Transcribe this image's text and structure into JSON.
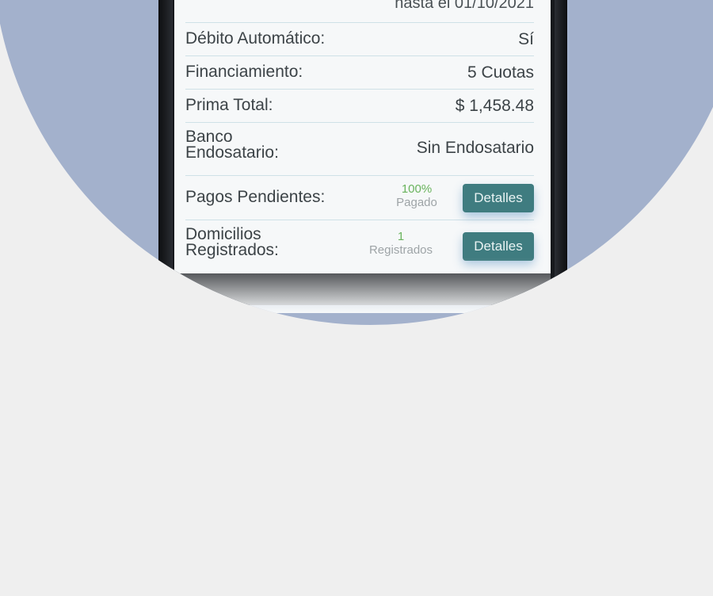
{
  "policy_details": {
    "vigencia_value": "hasta el 01/10/2021",
    "rows": [
      {
        "label": "Débito Automático:",
        "value": "Sí"
      },
      {
        "label": "Financiamiento:",
        "value": "5 Cuotas"
      },
      {
        "label": "Prima Total:",
        "value": "$ 1,458.48"
      }
    ],
    "banco": {
      "label_line1": "Banco",
      "label_line2": "Endosatario:",
      "value": "Sin Endosatario"
    },
    "pagos": {
      "label": "Pagos Pendientes:",
      "percent": "100%",
      "status": "Pagado",
      "button_label": "Detalles"
    },
    "domicilios": {
      "label_line1": "Domicilios",
      "label_line2": "Registrados:",
      "count": "1",
      "status": "Registrados",
      "button_label": "Detalles"
    }
  },
  "colors": {
    "background": "#efefef",
    "circle": "#a3b1cc",
    "button": "#3f7c80",
    "accent_green": "#69b35d",
    "divider": "#cfe1e7"
  }
}
